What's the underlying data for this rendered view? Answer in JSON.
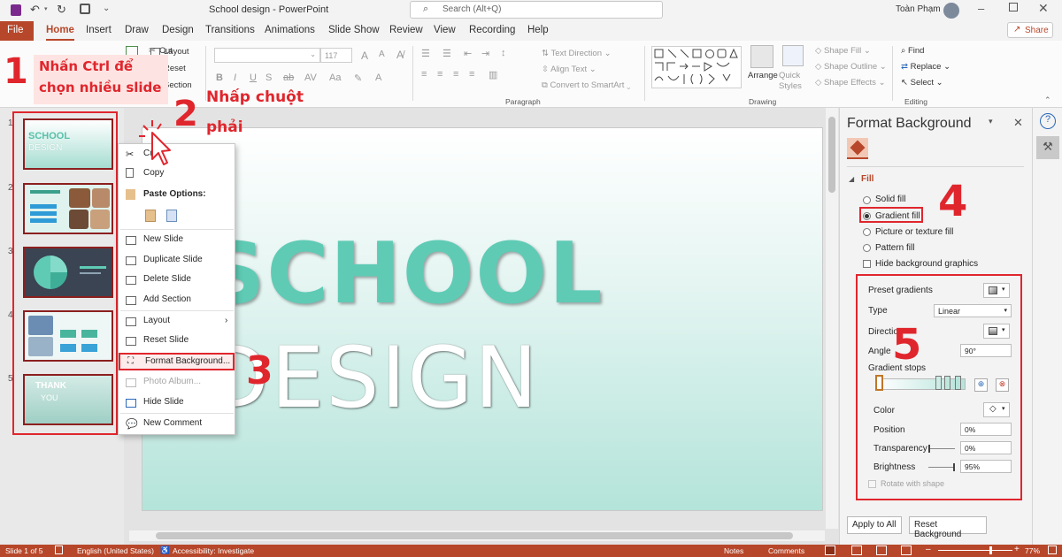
{
  "window": {
    "doc_title": "School design",
    "app_name": "PowerPoint",
    "title_sep": "  -  ",
    "search_placeholder": "Search (Alt+Q)",
    "user_name": "Toàn Phạm",
    "share_label": "Share"
  },
  "tabs": [
    "File",
    "Home",
    "Insert",
    "Draw",
    "Design",
    "Transitions",
    "Animations",
    "Slide Show",
    "Review",
    "View",
    "Recording",
    "Help"
  ],
  "ribbon": {
    "clipboard": {
      "cut": "Cut"
    },
    "slides": {
      "layout": "Layout",
      "reset": "Reset",
      "section": "Section"
    },
    "font": {
      "size": "117"
    },
    "paragraph": {
      "label": "Paragraph",
      "text_direction": "Text Direction",
      "align_text": "Align Text",
      "smartart": "Convert to SmartArt"
    },
    "drawing": {
      "label": "Drawing",
      "arrange": "Arrange",
      "quick_styles": "Quick Styles",
      "shape_fill": "Shape Fill",
      "shape_outline": "Shape Outline",
      "shape_effects": "Shape Effects"
    },
    "editing": {
      "label": "Editing",
      "find": "Find",
      "replace": "Replace",
      "select": "Select"
    }
  },
  "thumbnails": [
    {
      "num": "1",
      "t1": "SCHOOL",
      "t2": "DESIGN"
    },
    {
      "num": "2"
    },
    {
      "num": "3"
    },
    {
      "num": "4"
    },
    {
      "num": "5",
      "t1": "THANK",
      "t2": "YOU"
    }
  ],
  "slide": {
    "line1": "SCHOOL",
    "line2": "DESIGN"
  },
  "context_menu": {
    "cut": "Cut",
    "copy": "Copy",
    "paste_options": "Paste Options:",
    "new_slide": "New Slide",
    "duplicate_slide": "Duplicate Slide",
    "delete_slide": "Delete Slide",
    "add_section": "Add Section",
    "layout": "Layout",
    "reset_slide": "Reset Slide",
    "format_background": "Format Background...",
    "photo_album": "Photo Album...",
    "hide_slide": "Hide Slide",
    "new_comment": "New Comment"
  },
  "format_pane": {
    "title": "Format Background",
    "section": "Fill",
    "solid_fill": "Solid fill",
    "gradient_fill": "Gradient fill",
    "picture_fill": "Picture or texture fill",
    "pattern_fill": "Pattern fill",
    "hide_graphics": "Hide background graphics",
    "preset_gradients": "Preset gradients",
    "type_label": "Type",
    "type_value": "Linear",
    "direction": "Direction",
    "angle_label": "Angle",
    "angle_value": "90°",
    "gradient_stops": "Gradient stops",
    "color": "Color",
    "position_label": "Position",
    "position_value": "0%",
    "transparency_label": "Transparency",
    "transparency_value": "0%",
    "brightness_label": "Brightness",
    "brightness_value": "95%",
    "rotate_with_shape": "Rotate with shape",
    "apply_all": "Apply to All",
    "reset_background": "Reset Background"
  },
  "annotations": {
    "n1": "1",
    "t1_line1": "Nhấn Ctrl để",
    "t1_line2": "chọn nhiều slide",
    "n2": "2",
    "t2_line1": "Nhấp chuột",
    "t2_line2": "phải",
    "n3": "3",
    "n4": "4",
    "n5": "5"
  },
  "status": {
    "slide": "Slide 1 of 5",
    "language": "English (United States)",
    "accessibility": "Accessibility: Investigate",
    "notes": "Notes",
    "comments": "Comments",
    "zoom": "77%"
  },
  "colors": {
    "accent": "#b7472a",
    "annotation_red": "#e0262d",
    "teal": "#5fcbb5"
  }
}
